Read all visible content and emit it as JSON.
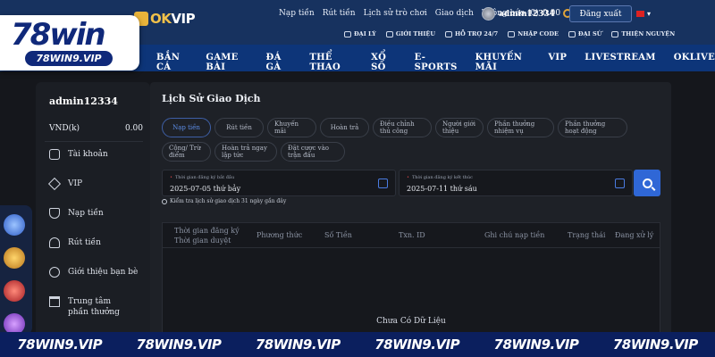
{
  "header": {
    "brand_partner": {
      "ok": "OK",
      "vip": "VIP"
    },
    "nav": [
      "Nạp tiền",
      "Rút tiền",
      "Lịch sử trò chơi",
      "Giao dịch",
      "Thông báo (0)"
    ],
    "username": "admin12334",
    "balance": "0.00",
    "logout_label": "Đăng xuất",
    "language_flag": "vn-flag-icon",
    "subnav": [
      "ĐẠI LÝ",
      "GIỚI THIỆU",
      "HỖ TRỢ 24/7",
      "NHẬP CODE",
      "ĐẠI SỨ",
      "THIỆN NGUYỆN"
    ]
  },
  "logo": {
    "name": "78win",
    "domain": "78WIN9.VIP"
  },
  "main_nav": [
    "BẮN CÁ",
    "GAME BÀI",
    "ĐÁ GÀ",
    "THỂ THAO",
    "XỔ SỐ",
    "E-SPORTS",
    "KHUYẾN MÃI",
    "VIP",
    "LIVESTREAM",
    "OKLIVE"
  ],
  "sidebar": {
    "username": "admin12334",
    "currency_label": "VND(k)",
    "balance": "0.00",
    "items": [
      {
        "label": "Tài khoản",
        "icon": "user-icon"
      },
      {
        "label": "VIP",
        "icon": "vip-icon"
      },
      {
        "label": "Nạp tiền",
        "icon": "deposit-icon"
      },
      {
        "label": "Rút tiền",
        "icon": "withdraw-icon"
      },
      {
        "label": "Giới thiệu bạn bè",
        "icon": "referral-icon"
      },
      {
        "label": "Trung tâm phần thưởng",
        "icon": "gift-icon"
      }
    ]
  },
  "content": {
    "title": "Lịch Sử Giao Dịch",
    "filters": [
      "Nạp tiền",
      "Rút tiền",
      "Khuyến mãi",
      "Hoàn trả",
      "Điều chỉnh thủ công",
      "Người giới thiệu",
      "Phần thưởng nhiệm vụ",
      "Phần thưởng hoạt động",
      "Cộng/ Trừ điểm",
      "Hoàn trả ngay lập tức",
      "Đặt cược vào trận đấu"
    ],
    "active_filter": "Nạp tiền",
    "start_date": {
      "label": "Thời gian đăng ký bắt đầu",
      "value": "2025-07-05 thứ bảy"
    },
    "end_date": {
      "label": "Thời gian đăng ký kết thúc",
      "value": "2025-07-11 thứ sáu"
    },
    "hint": "Kiểm tra lịch sử giao dịch 31 ngày gần đây",
    "table_headers": [
      "Thời gian đăng ký",
      "Thời gian duyệt",
      "Phương thức",
      "Số Tiền",
      "Txn. ID",
      "Ghi chú nạp tiền",
      "Trạng thái",
      "Đang xử lý"
    ],
    "empty_text": "Chưa Có Dữ Liệu"
  },
  "banner": [
    "78WIN9.VIP",
    "78WIN9.VIP",
    "78WIN9.VIP",
    "78WIN9.VIP",
    "78WIN9.VIP",
    "78WIN9.VIP"
  ],
  "colors": {
    "header_bg": "#17325f",
    "nav_bg": "#0d3579",
    "accent": "#2f67d6",
    "page_bg": "#15171c"
  }
}
